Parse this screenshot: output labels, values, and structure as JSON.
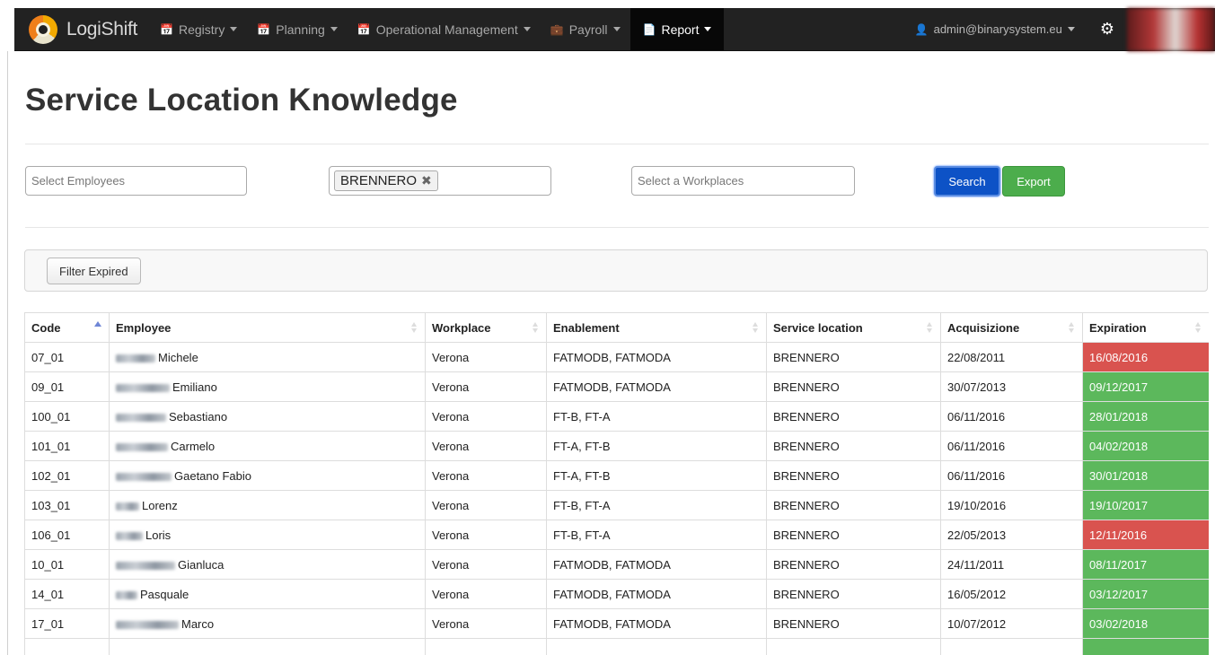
{
  "navbar": {
    "brand": "LogiShift",
    "items": [
      {
        "label": "Registry",
        "icon": "calendar-icon",
        "active": false
      },
      {
        "label": "Planning",
        "icon": "calendar-icon",
        "active": false
      },
      {
        "label": "Operational Management",
        "icon": "calendar-icon",
        "active": false
      },
      {
        "label": "Payroll",
        "icon": "briefcase-icon",
        "active": false
      },
      {
        "label": "Report",
        "icon": "file-icon",
        "active": true
      }
    ],
    "user": "admin@binarysystem.eu"
  },
  "page": {
    "title": "Service Location Knowledge"
  },
  "filters": {
    "employees_placeholder": "Select Employees",
    "location_tag": "BRENNERO",
    "workplaces_placeholder": "Select a Workplaces",
    "search_label": "Search",
    "export_label": "Export"
  },
  "toolbar": {
    "filter_label": "Filter Expired"
  },
  "table": {
    "columns": [
      "Code",
      "Employee",
      "Workplace",
      "Enablement",
      "Service location",
      "Acquisizione",
      "Expiration"
    ],
    "rows": [
      {
        "code": "07_01",
        "employee": "Michele",
        "workplace": "Verona",
        "enablement": "FATMODB, FATMODA",
        "location": "BRENNERO",
        "acquired": "22/08/2011",
        "expiration": "16/08/2016",
        "expired": true
      },
      {
        "code": "09_01",
        "employee": "Emiliano",
        "workplace": "Verona",
        "enablement": "FATMODB, FATMODA",
        "location": "BRENNERO",
        "acquired": "30/07/2013",
        "expiration": "09/12/2017",
        "expired": false
      },
      {
        "code": "100_01",
        "employee": "Sebastiano",
        "workplace": "Verona",
        "enablement": "FT-B, FT-A",
        "location": "BRENNERO",
        "acquired": "06/11/2016",
        "expiration": "28/01/2018",
        "expired": false
      },
      {
        "code": "101_01",
        "employee": "Carmelo",
        "workplace": "Verona",
        "enablement": "FT-A, FT-B",
        "location": "BRENNERO",
        "acquired": "06/11/2016",
        "expiration": "04/02/2018",
        "expired": false
      },
      {
        "code": "102_01",
        "employee": "Gaetano Fabio",
        "workplace": "Verona",
        "enablement": "FT-A, FT-B",
        "location": "BRENNERO",
        "acquired": "06/11/2016",
        "expiration": "30/01/2018",
        "expired": false
      },
      {
        "code": "103_01",
        "employee": "Lorenz",
        "workplace": "Verona",
        "enablement": "FT-B, FT-A",
        "location": "BRENNERO",
        "acquired": "19/10/2016",
        "expiration": "19/10/2017",
        "expired": false
      },
      {
        "code": "106_01",
        "employee": "Loris",
        "workplace": "Verona",
        "enablement": "FT-B, FT-A",
        "location": "BRENNERO",
        "acquired": "22/05/2013",
        "expiration": "12/11/2016",
        "expired": true
      },
      {
        "code": "10_01",
        "employee": "Gianluca",
        "workplace": "Verona",
        "enablement": "FATMODB, FATMODA",
        "location": "BRENNERO",
        "acquired": "24/11/2011",
        "expiration": "08/11/2017",
        "expired": false
      },
      {
        "code": "14_01",
        "employee": "Pasquale",
        "workplace": "Verona",
        "enablement": "FATMODB, FATMODA",
        "location": "BRENNERO",
        "acquired": "16/05/2012",
        "expiration": "03/12/2017",
        "expired": false
      },
      {
        "code": "17_01",
        "employee": "Marco",
        "workplace": "Verona",
        "enablement": "FATMODB, FATMODA",
        "location": "BRENNERO",
        "acquired": "10/07/2012",
        "expiration": "03/02/2018",
        "expired": false
      },
      {
        "code": "",
        "employee": "",
        "workplace": "",
        "enablement": "",
        "location": "",
        "acquired": "",
        "expiration": "",
        "expired": false
      }
    ]
  },
  "colors": {
    "expired": "#d9534f",
    "valid": "#5cb85c",
    "primary": "#0d52c6",
    "success": "#4cad4c"
  }
}
